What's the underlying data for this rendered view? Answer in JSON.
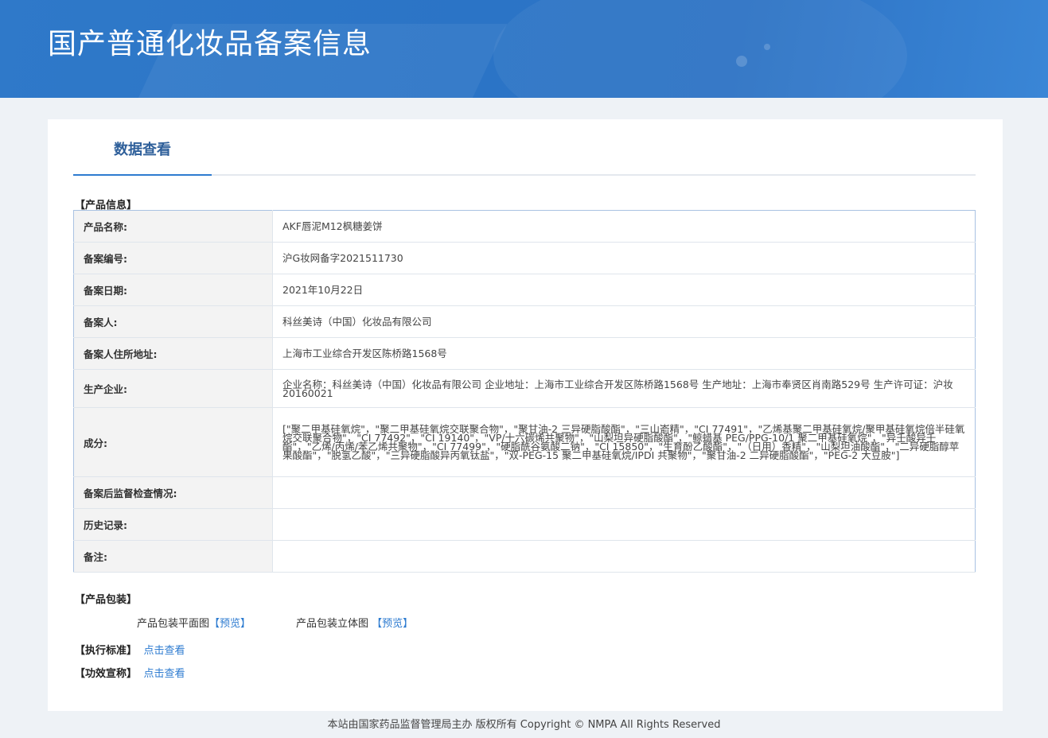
{
  "header": {
    "title": "国产普通化妆品备案信息"
  },
  "tabs": {
    "active_label": "数据查看"
  },
  "product_info": {
    "section_label": "【产品信息】",
    "rows": [
      {
        "key": "产品名称:",
        "value": "AKF唇泥M12枫糖姜饼"
      },
      {
        "key": "备案编号:",
        "value": "沪G妆网备字2021511730"
      },
      {
        "key": "备案日期:",
        "value": "2021年10月22日"
      },
      {
        "key": "备案人:",
        "value": "科丝美诗（中国）化妆品有限公司"
      },
      {
        "key": "备案人住所地址:",
        "value": "上海市工业综合开发区陈桥路1568号"
      },
      {
        "key": "生产企业:",
        "value": "企业名称：科丝美诗（中国）化妆品有限公司 企业地址：上海市工业综合开发区陈桥路1568号 生产地址：上海市奉贤区肖南路529号 生产许可证：沪妆20160021"
      },
      {
        "key": "成分:",
        "value": "[\"聚二甲基硅氧烷\"，\"聚二甲基硅氧烷交联聚合物\"，\"聚甘油-2 三异硬脂酸酯\"，\"三山嵛精\"，\"CI 77491\"，\"乙烯基聚二甲基硅氧烷/聚甲基硅氧烷倍半硅氧烷交联聚合物\"，\"CI 77492\"，\"CI 19140\"，\"VP/十六碳烯共聚物\"，\"山梨坦异硬脂酸酯\"，\"鲸蜡基 PEG/PPG-10/1 聚二甲基硅氧烷\"，\"异壬酸异壬酯\"，\"乙烯/丙烯/苯乙烯共聚物\"，\"CI 77499\"，\"硬脂酰谷氨酸二钠\"，\"CI 15850\"，\"生育酚乙酸酯\"，\"（日用）香精\"，\"山梨坦油酸酯\"，\"二异硬脂醇苹果酸酯\"，\"脱氢乙酸\"，\"三异硬脂酸异丙氧钛盐\"，\"双-PEG-15 聚二甲基硅氧烷/IPDI 共聚物\"，\"聚甘油-2 二异硬脂酸酯\"，\"PEG-2 大豆胺\"]"
      },
      {
        "key": "备案后监督检查情况:",
        "value": ""
      },
      {
        "key": "历史记录:",
        "value": ""
      },
      {
        "key": "备注:",
        "value": ""
      }
    ]
  },
  "packaging": {
    "section_label": "【产品包装】",
    "flat_label": "产品包装平面图",
    "flat_link": "【预览】",
    "solid_label": "产品包装立体图",
    "solid_link": "【预览】"
  },
  "standard": {
    "label": "【执行标准】",
    "link": "点击查看"
  },
  "efficacy": {
    "label": "【功效宣称】",
    "link": "点击查看"
  },
  "footer": {
    "text": "本站由国家药品监督管理局主办 版权所有 Copyright © NMPA All Rights Reserved"
  }
}
